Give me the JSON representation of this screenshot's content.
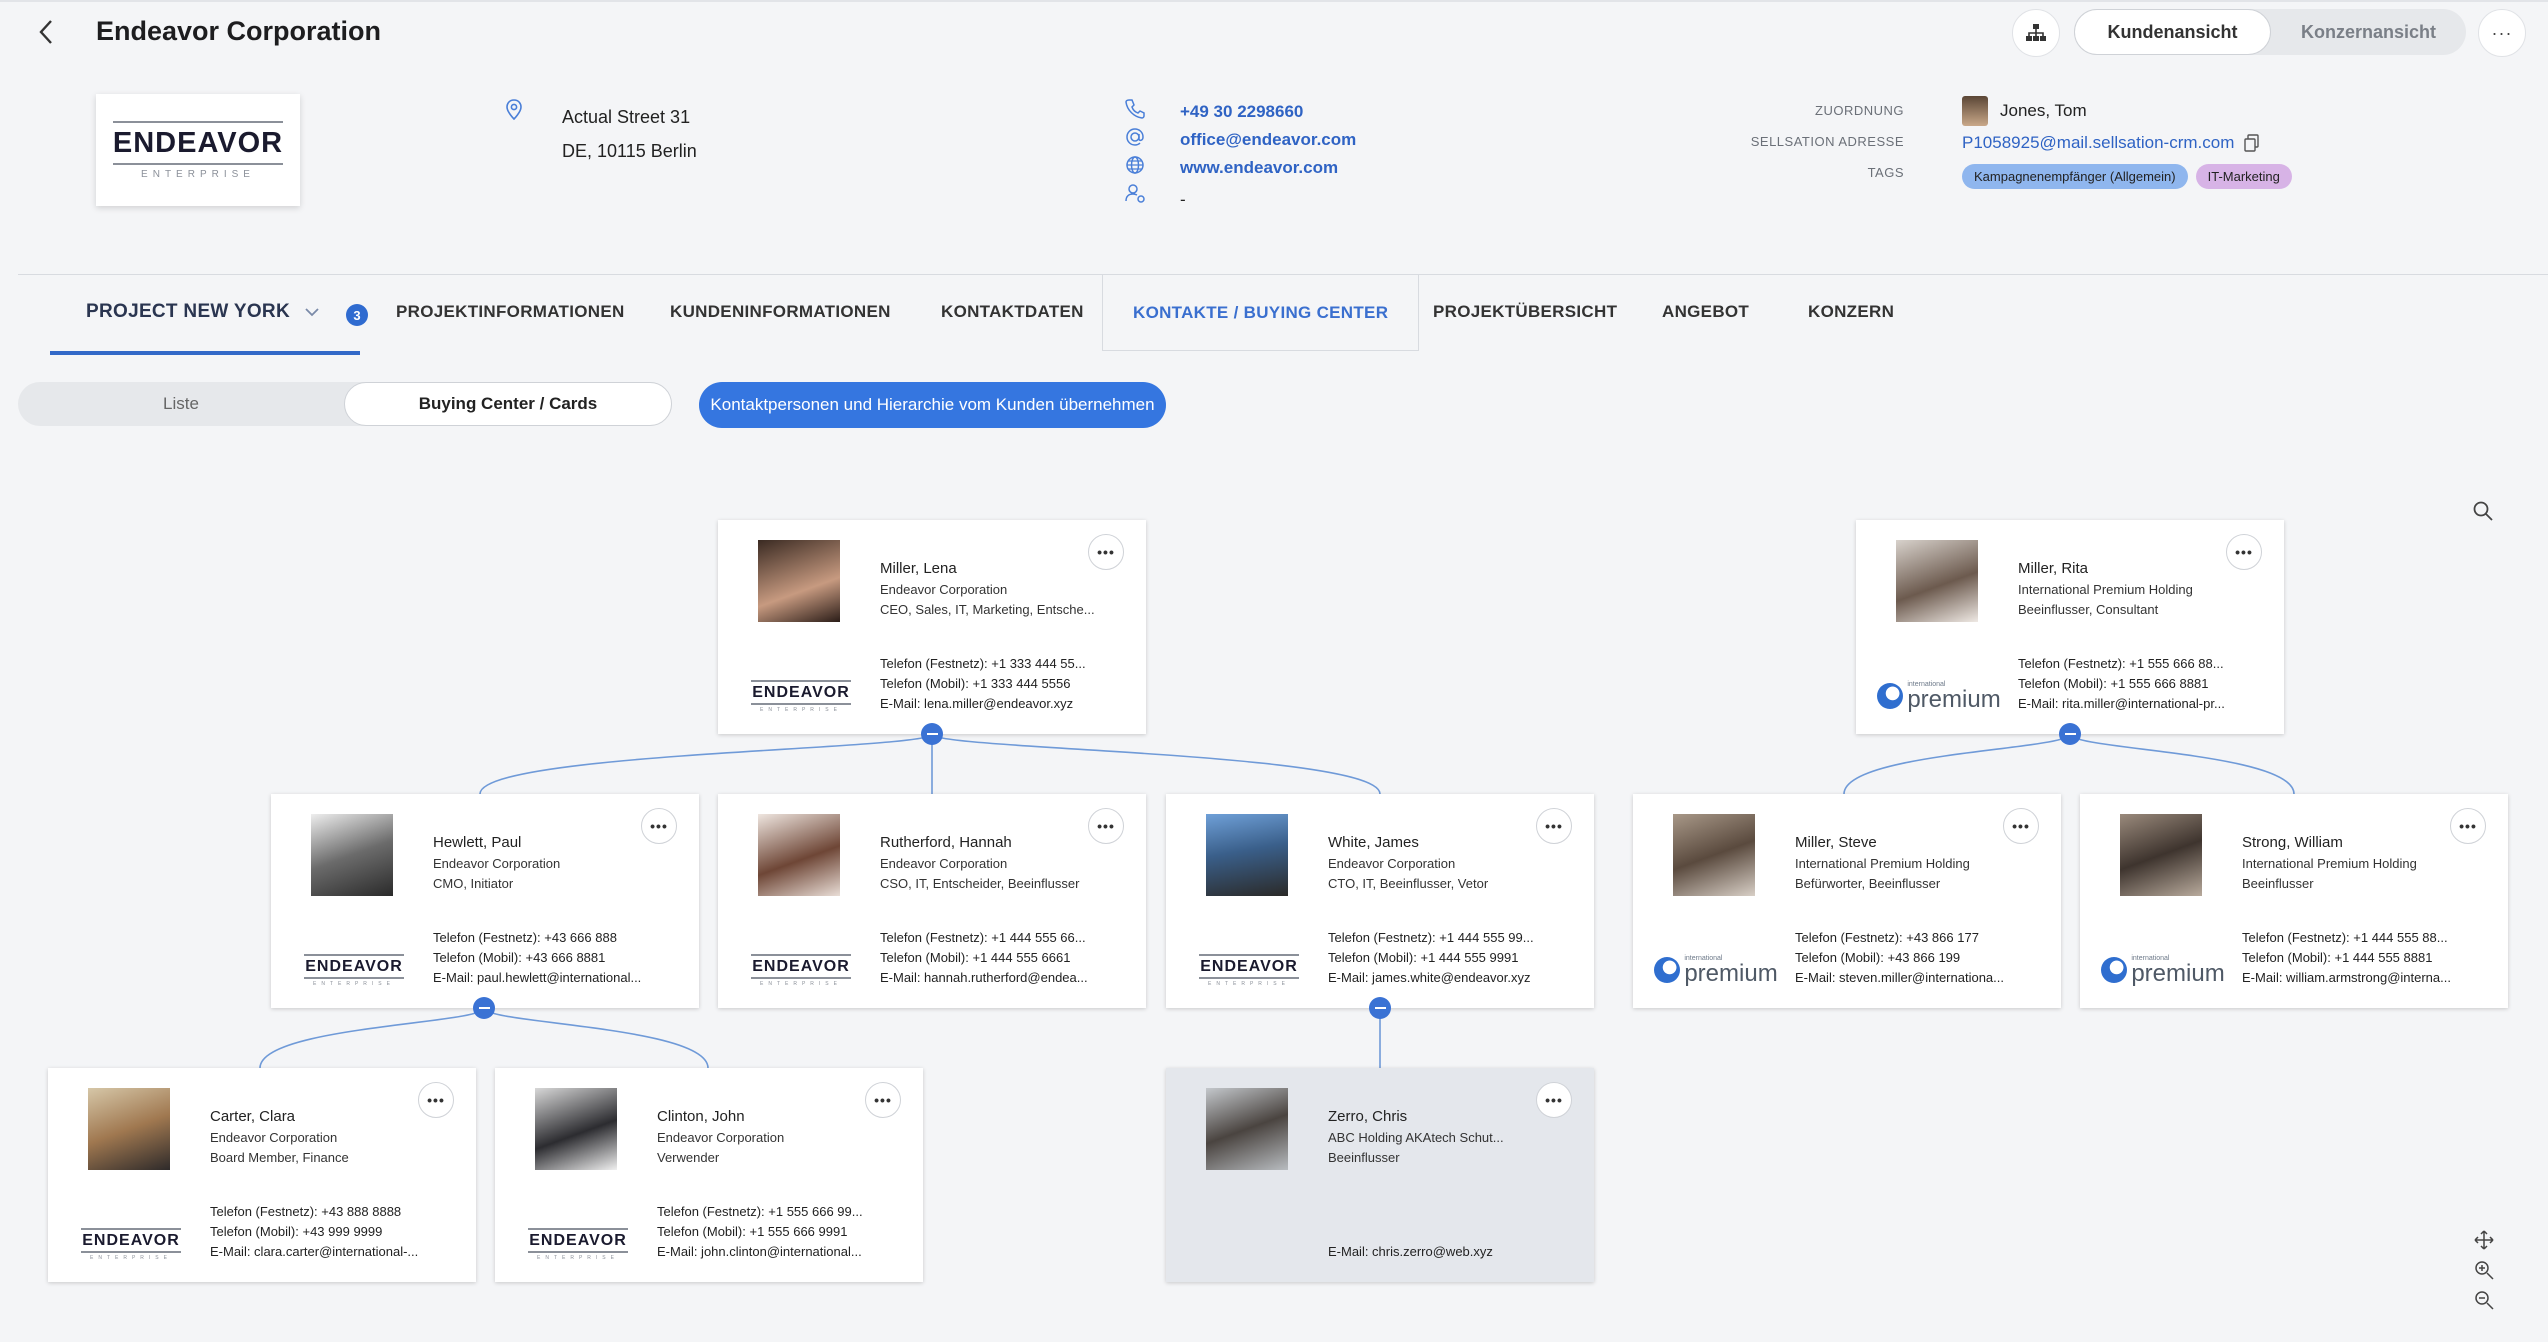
{
  "header": {
    "title": "Endeavor Corporation",
    "view_customer": "Kundenansicht",
    "view_group": "Konzernansicht",
    "more": "···"
  },
  "company": {
    "logo_word": "ENDEAVOR",
    "logo_sub": "ENTERPRISE",
    "street": "Actual Street 31",
    "city": "DE, 10115 Berlin",
    "phone": "+49 30 2298660",
    "email": "office@endeavor.com",
    "web": "www.endeavor.com",
    "contact": "-"
  },
  "meta": {
    "label_owner": "ZUORDNUNG",
    "label_address": "SELLSATION ADRESSE",
    "label_tags": "TAGS",
    "owner": "Jones, Tom",
    "sellsation_email": "P1058925@mail.sellsation-crm.com",
    "tags": [
      {
        "label": "Kampagnenempfänger (Allgemein)",
        "color": "#8fb6ee"
      },
      {
        "label": "IT-Marketing",
        "color": "#d7b3e6"
      }
    ]
  },
  "tabs": {
    "project": "PROJECT NEW YORK",
    "project_badge": "3",
    "t1": "PROJEKTINFORMATIONEN",
    "t2": "KUNDENINFORMATIONEN",
    "t3": "KONTAKTDATEN",
    "t4": "KONTAKTE / BUYING CENTER",
    "t5": "PROJEKTÜBERSICHT",
    "t6": "ANGEBOT",
    "t7": "KONZERN"
  },
  "controls": {
    "list": "Liste",
    "cards": "Buying Center / Cards",
    "import": "Kontaktpersonen und Hierarchie vom Kunden übernehmen"
  },
  "cards": {
    "lena": {
      "name": "Miller, Lena",
      "company": "Endeavor Corporation",
      "role": "CEO, Sales, IT, Marketing, Entsche...",
      "ph1": "Telefon (Festnetz): +1 333 444 55...",
      "ph2": "Telefon (Mobil): +1 333 444 5556",
      "mail": "E-Mail: lena.miller@endeavor.xyz"
    },
    "rita": {
      "name": "Miller, Rita",
      "company": "International Premium Holding",
      "role": "Beeinflusser, Consultant",
      "ph1": "Telefon (Festnetz): +1 555 666 88...",
      "ph2": "Telefon (Mobil): +1 555 666 8881",
      "mail": "E-Mail: rita.miller@international-pr..."
    },
    "paul": {
      "name": "Hewlett, Paul",
      "company": "Endeavor Corporation",
      "role": "CMO, Initiator",
      "ph1": "Telefon (Festnetz): +43 666 888",
      "ph2": "Telefon (Mobil): +43 666 8881",
      "mail": "E-Mail: paul.hewlett@international..."
    },
    "hannah": {
      "name": "Rutherford, Hannah",
      "company": "Endeavor Corporation",
      "role": "CSO, IT, Entscheider, Beeinflusser",
      "ph1": "Telefon (Festnetz): +1 444 555 66...",
      "ph2": "Telefon (Mobil): +1 444 555 6661",
      "mail": "E-Mail: hannah.rutherford@endea..."
    },
    "james": {
      "name": "White, James",
      "company": "Endeavor Corporation",
      "role": "CTO, IT, Beeinflusser, Vetor",
      "ph1": "Telefon (Festnetz): +1 444 555 99...",
      "ph2": "Telefon (Mobil): +1 444 555 9991",
      "mail": "E-Mail: james.white@endeavor.xyz"
    },
    "steve": {
      "name": "Miller, Steve",
      "company": "International Premium Holding",
      "role": "Befürworter, Beeinflusser",
      "ph1": "Telefon (Festnetz): +43 866 177",
      "ph2": "Telefon (Mobil): +43 866 199",
      "mail": "E-Mail: steven.miller@internationa..."
    },
    "william": {
      "name": "Strong, William",
      "company": "International Premium Holding",
      "role": "Beeinflusser",
      "ph1": "Telefon (Festnetz): +1 444 555 88...",
      "ph2": "Telefon (Mobil): +1 444 555 8881",
      "mail": "E-Mail: william.armstrong@interna..."
    },
    "clara": {
      "name": "Carter, Clara",
      "company": "Endeavor Corporation",
      "role": "Board Member, Finance",
      "ph1": "Telefon (Festnetz): +43 888 8888",
      "ph2": "Telefon (Mobil): +43 999 9999",
      "mail": "E-Mail: clara.carter@international-..."
    },
    "john": {
      "name": "Clinton, John",
      "company": "Endeavor Corporation",
      "role": "Verwender",
      "ph1": "Telefon (Festnetz): +1 555 666 99...",
      "ph2": "Telefon (Mobil): +1 555 666 9991",
      "mail": "E-Mail: john.clinton@international..."
    },
    "chris": {
      "name": "Zerro, Chris",
      "company": "ABC Holding AKAtech Schut...",
      "role": "Beeinflusser",
      "ph1": "",
      "ph2": "",
      "mail": "E-Mail: chris.zerro@web.xyz"
    }
  },
  "premium_logo": {
    "small": "international",
    "big": "premium"
  },
  "colors": {
    "accent": "#3576e0",
    "line": "#6f9ad8"
  }
}
